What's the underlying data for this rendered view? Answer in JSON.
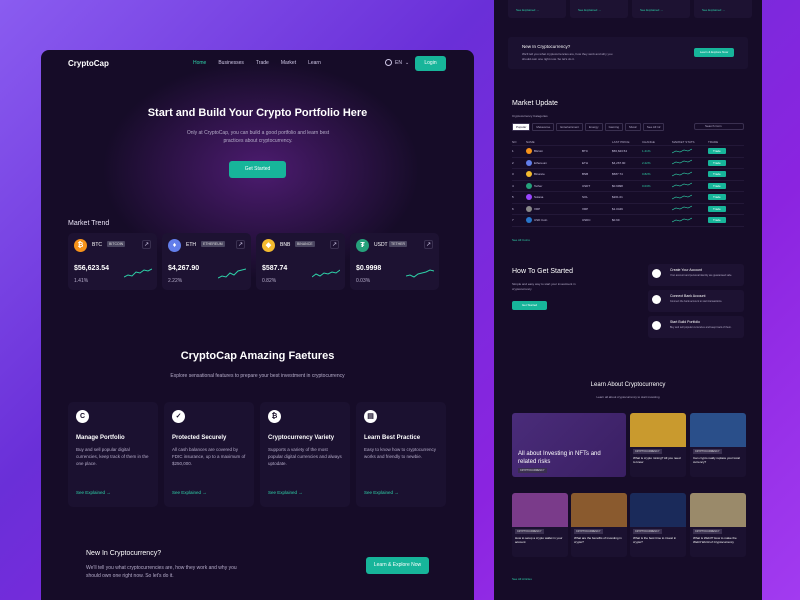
{
  "left": {
    "logo": "CryptoCap",
    "nav": [
      "Home",
      "Businesses",
      "Trade",
      "Market",
      "Learn"
    ],
    "lang": "EN",
    "login": "Login",
    "hero": {
      "title": "Start and Build Your Crypto Portfolio Here",
      "subtitle": "Only at CryptoCap, you can build a good portfolio and learn best practices about cryptocurrency.",
      "cta": "Get Started"
    },
    "market_trend_label": "Market Trend",
    "cards": [
      {
        "symbol": "BTC",
        "badge": "BITCOIN",
        "price": "$56,623.54",
        "change": "1.41%",
        "icon": "bitcoin-icon",
        "color": "#f7931a",
        "glyph": "₿"
      },
      {
        "symbol": "ETH",
        "badge": "ETHEREUM",
        "price": "$4,267.90",
        "change": "2.22%",
        "icon": "ethereum-icon",
        "color": "#627eea",
        "glyph": "♦"
      },
      {
        "symbol": "BNB",
        "badge": "BINANCE",
        "price": "$587.74",
        "change": "0.82%",
        "icon": "binance-icon",
        "color": "#f3ba2f",
        "glyph": "◆"
      },
      {
        "symbol": "USDT",
        "badge": "TETHER",
        "price": "$0.9998",
        "change": "0.03%",
        "icon": "tether-icon",
        "color": "#26a17b",
        "glyph": "₮"
      }
    ],
    "features": {
      "title": "CryptoCap Amazing Faetures",
      "subtitle": "Explore sensational features to prepare your best investment in cryptocurrency",
      "items": [
        {
          "name": "Manage Portfolio",
          "desc": "Buy and sell popular digital currencies, keep track of them in the one place.",
          "link": "See Explained →",
          "icon": "c-icon",
          "glyph": "C"
        },
        {
          "name": "Protected Securely",
          "desc": "All cash balances are covered by FDIC insurance, up to a maximum of $250,000.",
          "link": "See Explained →",
          "icon": "shield-check-icon",
          "glyph": "✓"
        },
        {
          "name": "Cryptocurrency Variety",
          "desc": "Supports a variety of the most popular digital currencies and always uptodate.",
          "link": "See Explained →",
          "icon": "bitcoin-icon",
          "glyph": "₿"
        },
        {
          "name": "Learn Best Practice",
          "desc": "Easy to know how to cryptocurrency works and friendly to newbie.",
          "link": "See Explained →",
          "icon": "document-icon",
          "glyph": "▤"
        }
      ]
    },
    "new_section": {
      "title": "New In Cryptocurrency?",
      "subtitle": "We'll tell you what cryptocurrencies are, how they work and why you should own one right now. So let's do it.",
      "button": "Learn & Explore Now"
    }
  },
  "right": {
    "top_links": [
      "See Explained →",
      "See Explained →",
      "See Explained →",
      "See Explained →"
    ],
    "new_section": {
      "title": "New In Cryptocurrency?",
      "subtitle": "We'll tell you what cryptocurrencies are, how they work and why you should own one right now. So let's do it.",
      "button": "Learn & Explore Now"
    },
    "market": {
      "title": "Market Update",
      "categories": "Cryptocurrency Categories",
      "tabs": [
        "Popular",
        "Metaverse",
        "Entertainment",
        "Energy",
        "Gaming",
        "Music",
        "See All 12"
      ],
      "search": "Search Coin",
      "headers": [
        "NO",
        "NAME",
        "",
        "LAST PRICE",
        "CHANGE",
        "MARKET STATS",
        "TRADE"
      ],
      "rows": [
        {
          "no": "1",
          "name": "Bitcoin",
          "sym": "BTC",
          "price": "$56,623.54",
          "change": "1.41%",
          "color": "#f7931a"
        },
        {
          "no": "2",
          "name": "Ethereum",
          "sym": "ETH",
          "price": "$4,267.90",
          "change": "2.22%",
          "color": "#627eea"
        },
        {
          "no": "3",
          "name": "Binance",
          "sym": "BNB",
          "price": "$587.74",
          "change": "0.82%",
          "color": "#f3ba2f"
        },
        {
          "no": "4",
          "name": "Tether",
          "sym": "USDT",
          "price": "$0.9998",
          "change": "0.03%",
          "color": "#26a17b"
        },
        {
          "no": "5",
          "name": "Solana",
          "sym": "SOL",
          "price": "$201.01",
          "change": "",
          "color": "#9945ff"
        },
        {
          "no": "6",
          "name": "XRP",
          "sym": "XRP",
          "price": "$1.0449",
          "change": "",
          "color": "#888888"
        },
        {
          "no": "7",
          "name": "USD Coin",
          "sym": "USDC",
          "price": "$0.99",
          "change": "",
          "color": "#2775ca"
        }
      ],
      "trade": "Trade",
      "see_all": "See All Coins"
    },
    "how": {
      "title": "How To Get Started",
      "subtitle": "Simple and easy way to start your investment in cryptocurrency",
      "button": "Get Started",
      "steps": [
        {
          "name": "Create Your Account",
          "desc": "Your account and personal identity are guaranteed safe.",
          "icon": "user-icon"
        },
        {
          "name": "Connect Bank Account",
          "desc": "Connect the bank account to start transactions.",
          "icon": "bank-card-icon"
        },
        {
          "name": "Start Build Portfolio",
          "desc": "Buy and sell popular currencies and keep track of them.",
          "icon": "portfolio-icon"
        }
      ]
    },
    "learn": {
      "title": "Learn About Cryptocurrency",
      "subtitle": "Learn all about cryptocurrency to start investing",
      "big": {
        "title": "All about Investing in NFTs and related risks",
        "tag": "CRYPTOCURRENCY"
      },
      "articles": [
        {
          "tag": "CRYPTOCURRENCY",
          "title": "What is crypto mining? All you need to know",
          "color": "#c99a2e"
        },
        {
          "tag": "CRYPTOCURRENCY",
          "title": "Can crypto really replace your local currency?",
          "color": "#2a4f8a"
        },
        {
          "tag": "CRYPTOCURRENCY",
          "title": "How to setup a crypto wallet in your account",
          "color": "#7a3b8a"
        },
        {
          "tag": "CRYPTOCURRENCY",
          "title": "What are the benefits of investing in crypto?",
          "color": "#8a5a2e"
        },
        {
          "tag": "CRYPTOCURRENCY",
          "title": "What is the best time to invest in crypto?",
          "color": "#1a2a5a"
        },
        {
          "tag": "CRYPTOCURRENCY",
          "title": "What is Web3? How to make the Web3 World of Cryptocurrency",
          "color": "#9a8a6a"
        }
      ],
      "see_all": "See All Articles"
    }
  }
}
